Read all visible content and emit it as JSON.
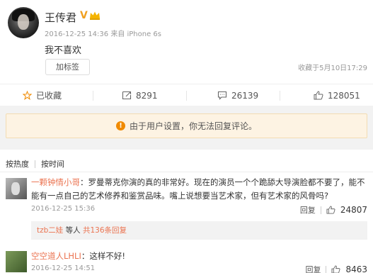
{
  "post": {
    "author": "王传君",
    "verified_badge": "V",
    "timestamp": "2016-12-25 14:36",
    "source": "来自 iPhone 6s",
    "content": "我不喜欢",
    "tag_button": "加标签",
    "saved_at": "收藏于5月10日17:29"
  },
  "actions": {
    "favorite": "已收藏",
    "repost_count": "8291",
    "comment_count": "26139",
    "like_count": "128051"
  },
  "notice": {
    "text": "由于用户设置，你无法回复评论。"
  },
  "sort": {
    "by_hot": "按热度",
    "by_time": "按时间"
  },
  "comments": [
    {
      "name": "一颗钟情小哥",
      "text": "：罗曼蒂克你演的真的非常好。现在的演员一个个跪舔大导演脸都不要了，能不能有一点自己的艺术修养和鉴赏品味。嘴上说想要当艺术家，但有艺术家的风骨吗?",
      "time": "2016-12-25 15:36",
      "reply_label": "回复",
      "likes": "24807",
      "replies_who": "tzb二娃",
      "replies_mid": "等人",
      "replies_more": "共136条回复"
    },
    {
      "name": "空空道人LHLI",
      "text": "：这样不好!",
      "time": "2016-12-25 14:51",
      "reply_label": "回复",
      "likes": "8463"
    }
  ],
  "colors": {
    "accent_orange": "#eb7350",
    "notice_bg": "#fdf3e3",
    "warning": "#f08a00"
  },
  "icons": {
    "favorite": "star-icon",
    "repost": "repost-icon",
    "comment": "comment-icon",
    "like": "thumbs-up-icon",
    "notice": "warning-icon"
  }
}
